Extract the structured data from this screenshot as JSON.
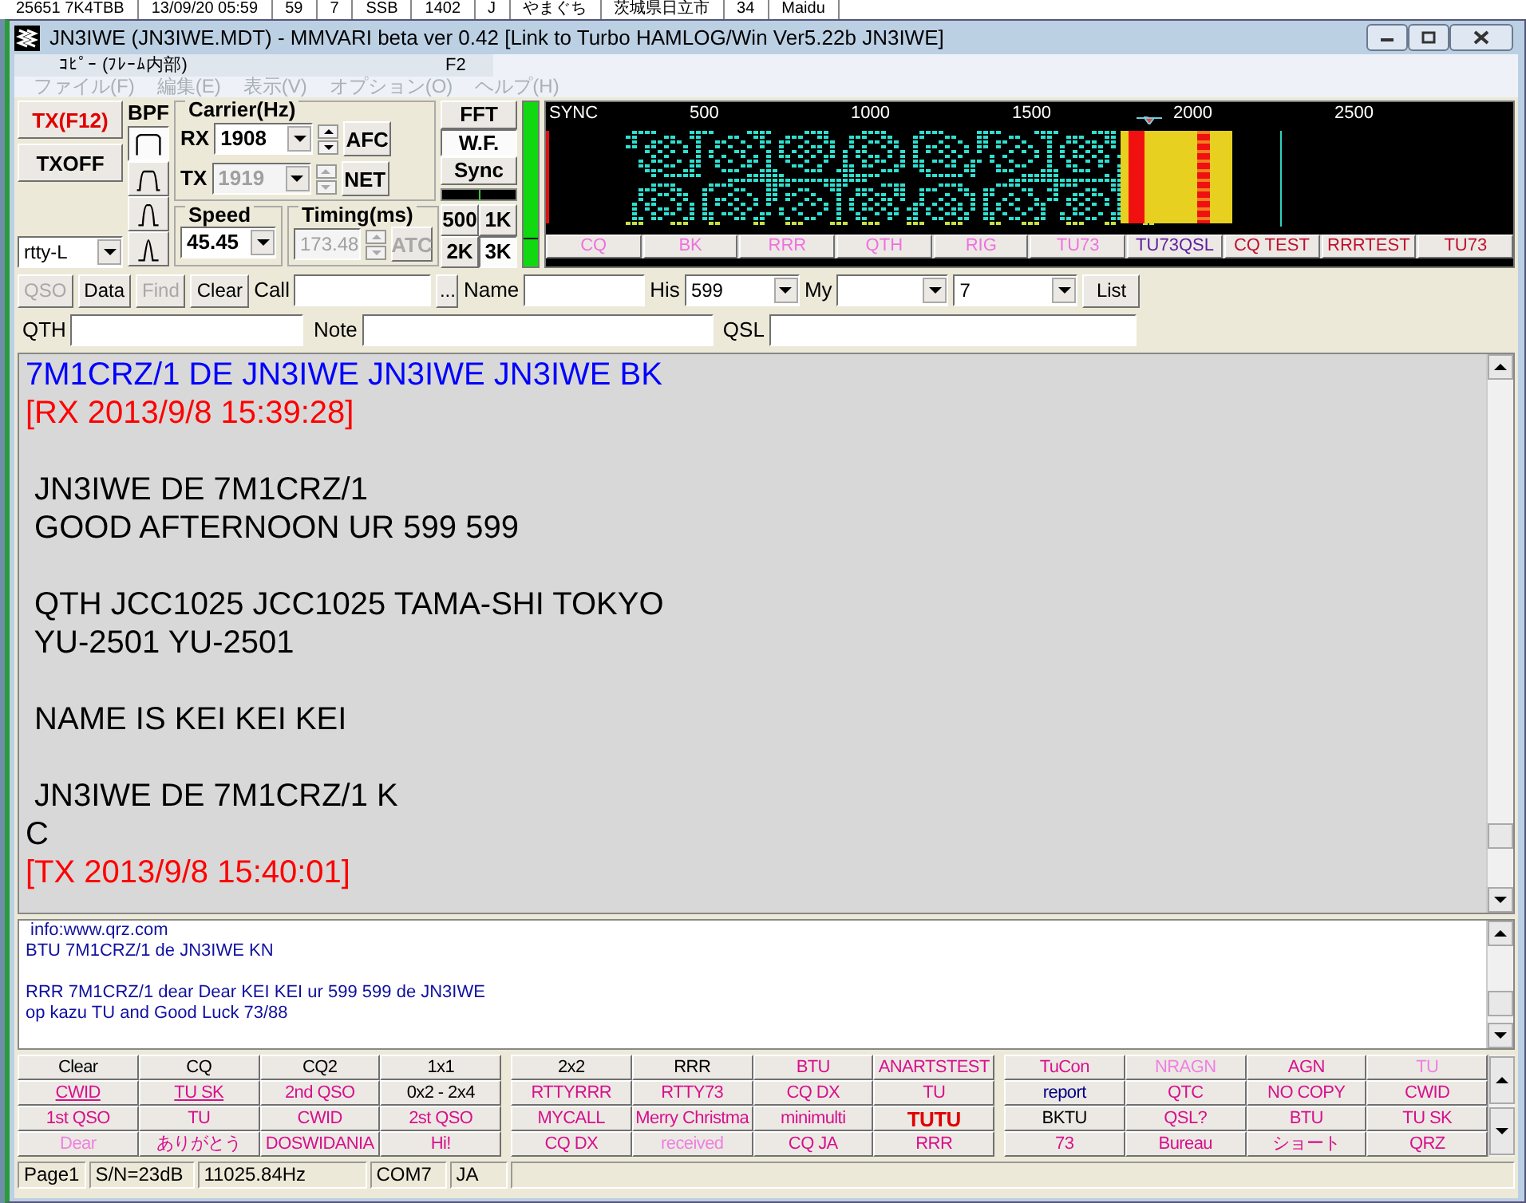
{
  "background_log_row": [
    "25651 7K4TBB",
    "13/09/20 05:59",
    "59",
    "7",
    "SSB",
    "1402",
    "J",
    "やまぐち",
    "茨城県日立市",
    "34",
    "Maidu"
  ],
  "window": {
    "title": "JN3IWE (JN3IWE.MDT) - MMVARI beta ver 0.42 [Link to Turbo HAMLOG/Win Ver5.22b JN3IWE]"
  },
  "popup_menu_item": {
    "label": "ｺﾋﾟｰ (ﾌﾚｰﾑ内部)",
    "shortcut": "F2"
  },
  "menu": [
    "ファイル(F)",
    "編集(E)",
    "表示(V)",
    "オプション(O)",
    "ヘルプ(H)"
  ],
  "tx_buttons": [
    {
      "label": "TX(F12)",
      "color": "#e00000"
    },
    {
      "label": "TXOFF",
      "color": "#000000"
    }
  ],
  "mode_combo": {
    "value": "rtty-L"
  },
  "bpf": {
    "label": "BPF",
    "filters": [
      {
        "selected": true
      },
      {
        "selected": false
      },
      {
        "selected": false
      },
      {
        "selected": false
      }
    ]
  },
  "carrier": {
    "label": "Carrier(Hz)",
    "rx": {
      "label": "RX",
      "value": "1908",
      "disabled": false
    },
    "tx": {
      "label": "TX",
      "value": "1919",
      "disabled": true
    },
    "afc": "AFC",
    "net": "NET"
  },
  "speed": {
    "label": "Speed",
    "value": "45.45"
  },
  "timing": {
    "label": "Timing(ms)",
    "value": "173.48",
    "disabled": true,
    "atc": "ATC"
  },
  "view_buttons": [
    {
      "label": "FFT",
      "selected": false
    },
    {
      "label": "W.F.",
      "selected": true
    },
    {
      "label": "Sync",
      "selected": false
    }
  ],
  "bandwidth_buttons": [
    {
      "label": "500",
      "selected": false
    },
    {
      "label": "1K",
      "selected": false
    },
    {
      "label": "2K",
      "selected": false
    },
    {
      "label": "3K",
      "selected": true
    }
  ],
  "spectrum": {
    "scale_labels": [
      "SYNC",
      "500",
      "1000",
      "1500",
      "2000",
      "2500"
    ],
    "macros": [
      {
        "label": "CQ",
        "color": "#f070e0"
      },
      {
        "label": "BK",
        "color": "#f070e0"
      },
      {
        "label": "RRR",
        "color": "#f070e0"
      },
      {
        "label": "QTH",
        "color": "#f070e0"
      },
      {
        "label": "RIG",
        "color": "#f070e0"
      },
      {
        "label": "TU73",
        "color": "#f070e0"
      },
      {
        "label": "TU73QSL",
        "color": "#6020a0"
      },
      {
        "label": "CQ TEST",
        "color": "#c01030"
      },
      {
        "label": "RRRTEST",
        "color": "#c01030"
      },
      {
        "label": "TU73",
        "color": "#c01030"
      }
    ]
  },
  "qso_buttons": [
    {
      "label": "QSO",
      "disabled": true
    },
    {
      "label": "Data",
      "disabled": false
    },
    {
      "label": "Find",
      "disabled": true
    },
    {
      "label": "Clear",
      "disabled": false
    }
  ],
  "call": {
    "label": "Call"
  },
  "browse_button": "...",
  "name": {
    "label": "Name"
  },
  "his": {
    "label": "His",
    "value": "599"
  },
  "my": {
    "label": "My"
  },
  "band_combo": {
    "value": "7"
  },
  "list_button": "List",
  "info_fields": [
    {
      "label": "QTH"
    },
    {
      "label": "Note"
    },
    {
      "label": "QSL"
    }
  ],
  "receive_text": [
    [
      {
        "text": "7M1CRZ/1 DE JN3IWE JN3IWE JN3IWE BK",
        "color": "#0000ff"
      },
      {
        "text": "[RX 2013/9/8 15:39:28]",
        "color": "#ff0000"
      }
    ],
    [
      {
        "text": " JN3IWE DE 7M1CRZ/1",
        "color": "#000000"
      },
      {
        "text": " GOOD AFTERNOON UR 599 599",
        "color": "#000000"
      }
    ],
    [
      {
        "text": " QTH JCC1025 JCC1025 TAMA-SHI TOKYO",
        "color": "#000000"
      },
      {
        "text": " YU-2501 YU-2501",
        "color": "#000000"
      }
    ],
    [
      {
        "text": " NAME IS KEI KEI KEI",
        "color": "#000000"
      }
    ],
    [
      {
        "text": " JN3IWE DE 7M1CRZ/1 K",
        "color": "#000000"
      },
      {
        "text": "C",
        "color": "#000000"
      },
      {
        "text": "[TX 2013/9/8 15:40:01]",
        "color": "#ff0000"
      }
    ]
  ],
  "transmit_text": [
    [
      " info:www.qrz.com",
      "BTU 7M1CRZ/1 de JN3IWE KN"
    ],
    [
      "RRR 7M1CRZ/1 dear Dear KEI KEI ur 599 599 de JN3IWE",
      "op kazu TU and Good Luck 73/88"
    ]
  ],
  "macros": [
    [
      {
        "label": "Clear",
        "color": "#000000",
        "kind": "plain"
      },
      {
        "label": "CQ",
        "color": "#000000",
        "kind": "plain"
      },
      {
        "label": "CQ2",
        "color": "#000000",
        "kind": "plain"
      },
      {
        "label": "1x1",
        "color": "#000000",
        "kind": "plain"
      },
      {
        "label": "2x2",
        "color": "#000000",
        "kind": "plain"
      },
      {
        "label": "RRR",
        "color": "#000000",
        "kind": "plain"
      },
      {
        "label": "BTU",
        "color": "#d8108c",
        "kind": "plain"
      },
      {
        "label": "ANARTSTEST",
        "color": "#d8108c",
        "kind": "plain"
      },
      {
        "label": "TuCon",
        "color": "#d8108c",
        "kind": "plain"
      },
      {
        "label": "NRAGN",
        "color": "#f080e0",
        "kind": "plain"
      },
      {
        "label": "AGN",
        "color": "#d8108c",
        "kind": "plain"
      },
      {
        "label": "TU",
        "color": "#f080e0",
        "kind": "plain"
      }
    ],
    [
      {
        "label": "CWID",
        "color": "#d8108c",
        "kind": "underline"
      },
      {
        "label": "TU SK",
        "color": "#d8108c",
        "kind": "underline"
      },
      {
        "label": "2nd QSO",
        "color": "#d8108c",
        "kind": "plain"
      },
      {
        "label": "0x2 - 2x4",
        "color": "#000000",
        "kind": "plain"
      },
      {
        "label": "RTTYRRR",
        "color": "#d8108c",
        "kind": "plain"
      },
      {
        "label": "RTTY73",
        "color": "#d8108c",
        "kind": "plain"
      },
      {
        "label": "CQ DX",
        "color": "#d8108c",
        "kind": "plain"
      },
      {
        "label": "TU",
        "color": "#d8108c",
        "kind": "plain"
      },
      {
        "label": "report",
        "color": "#000080",
        "kind": "plain"
      },
      {
        "label": "QTC",
        "color": "#d8108c",
        "kind": "plain"
      },
      {
        "label": "NO COPY",
        "color": "#d8108c",
        "kind": "plain"
      },
      {
        "label": "CWID",
        "color": "#d8108c",
        "kind": "plain"
      }
    ],
    [
      {
        "label": "1st QSO",
        "color": "#d8108c",
        "kind": "plain"
      },
      {
        "label": "TU",
        "color": "#d8108c",
        "kind": "plain"
      },
      {
        "label": "CWID",
        "color": "#d8108c",
        "kind": "plain"
      },
      {
        "label": "2st QSO",
        "color": "#d8108c",
        "kind": "plain"
      },
      {
        "label": "MYCALL",
        "color": "#d8108c",
        "kind": "plain"
      },
      {
        "label": "Merry Christma",
        "color": "#d8108c",
        "kind": "plain"
      },
      {
        "label": "minimulti",
        "color": "#d8108c",
        "kind": "plain"
      },
      {
        "label": "TUTU",
        "color": "#e00000",
        "kind": "bold"
      },
      {
        "label": "BKTU",
        "color": "#000000",
        "kind": "plain"
      },
      {
        "label": "QSL?",
        "color": "#d8108c",
        "kind": "plain"
      },
      {
        "label": "BTU",
        "color": "#d8108c",
        "kind": "plain"
      },
      {
        "label": "TU SK",
        "color": "#d8108c",
        "kind": "plain"
      }
    ],
    [
      {
        "label": "Dear",
        "color": "#f080e0",
        "kind": "plain"
      },
      {
        "label": "ありがとう",
        "color": "#d8108c",
        "kind": "plain"
      },
      {
        "label": "DOSWIDANIA",
        "color": "#d8108c",
        "kind": "plain"
      },
      {
        "label": "Hi!",
        "color": "#d8108c",
        "kind": "plain"
      },
      {
        "label": "CQ DX",
        "color": "#d8108c",
        "kind": "plain"
      },
      {
        "label": "received",
        "color": "#f080e0",
        "kind": "plain"
      },
      {
        "label": "CQ JA",
        "color": "#d8108c",
        "kind": "plain"
      },
      {
        "label": "RRR",
        "color": "#d8108c",
        "kind": "plain"
      },
      {
        "label": "73",
        "color": "#d8108c",
        "kind": "plain"
      },
      {
        "label": "Bureau",
        "color": "#d8108c",
        "kind": "plain"
      },
      {
        "label": "ショート",
        "color": "#d8108c",
        "kind": "plain"
      },
      {
        "label": "QRZ",
        "color": "#d8108c",
        "kind": "plain"
      }
    ]
  ],
  "status_bar": [
    "Page1",
    "S/N=23dB",
    "11025.84Hz",
    "COM7",
    "JA"
  ]
}
